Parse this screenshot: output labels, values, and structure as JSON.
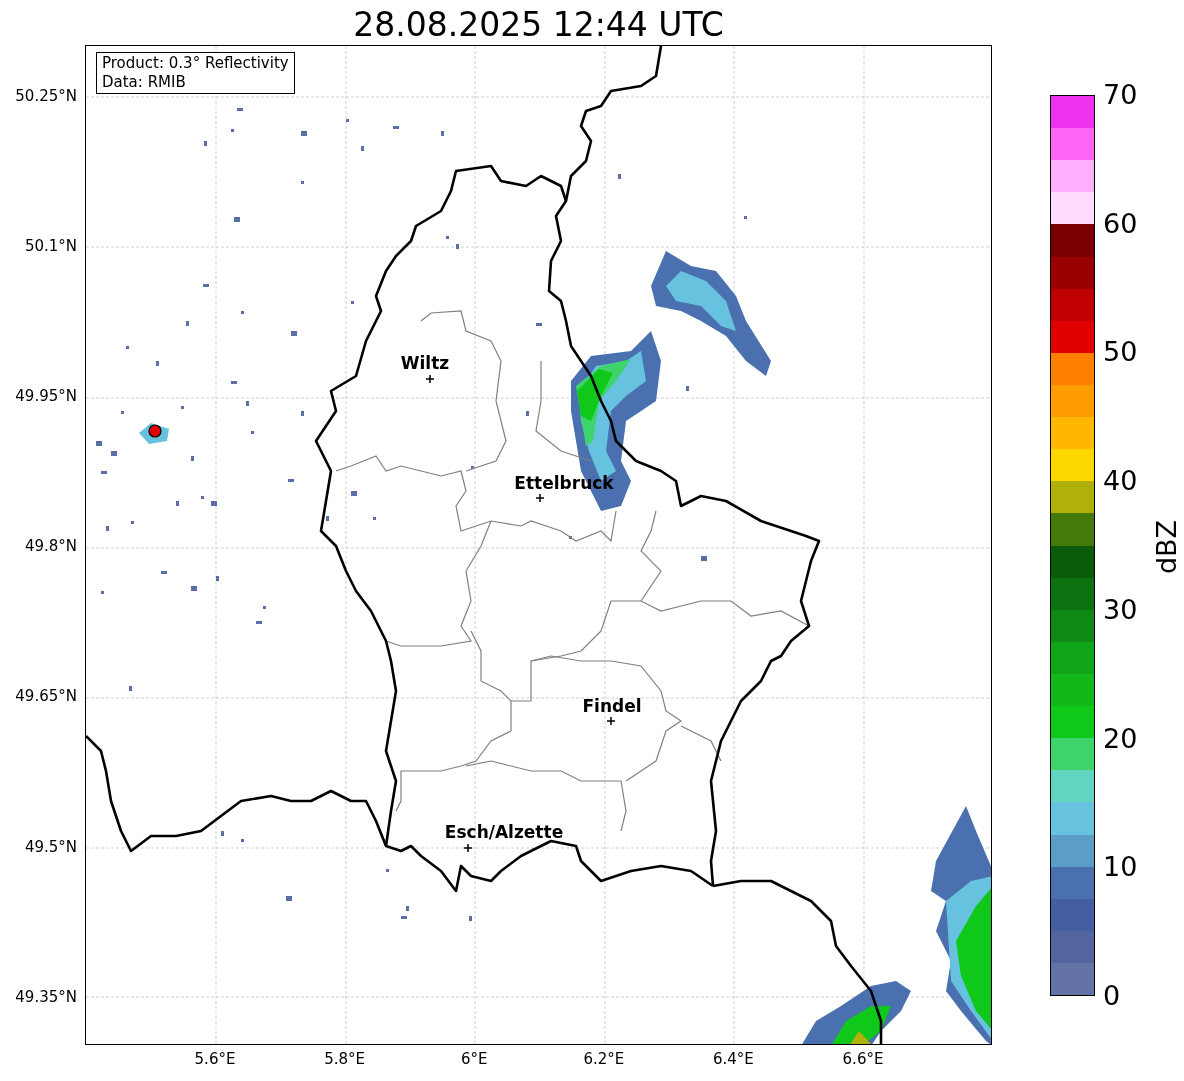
{
  "title": "28.08.2025 12:44 UTC",
  "info_box": {
    "lines": [
      "Product: 0.3° Reflectivity",
      "Data: RMIB"
    ]
  },
  "y_ticks": [
    "50.25°N",
    "50.1°N",
    "49.95°N",
    "49.8°N",
    "49.65°N",
    "49.5°N",
    "49.35°N"
  ],
  "x_ticks": [
    "5.6°E",
    "5.8°E",
    "6°E",
    "6.2°E",
    "6.4°E",
    "6.6°E"
  ],
  "places": [
    {
      "name": "Wiltz"
    },
    {
      "name": "Ettelbruck"
    },
    {
      "name": "Findel"
    },
    {
      "name": "Esch/Alzette"
    }
  ],
  "colorbar": {
    "label": "dBZ",
    "ticks": [
      "70",
      "60",
      "50",
      "40",
      "30",
      "20",
      "10",
      "0"
    ],
    "bins": [
      {
        "color": "#ee33ee"
      },
      {
        "color": "#ff66f8"
      },
      {
        "color": "#ffb0ff"
      },
      {
        "color": "#ffdcff"
      },
      {
        "color": "#780000"
      },
      {
        "color": "#9a0000"
      },
      {
        "color": "#c00000"
      },
      {
        "color": "#e00000"
      },
      {
        "color": "#ff8000"
      },
      {
        "color": "#ff9c00"
      },
      {
        "color": "#ffb700"
      },
      {
        "color": "#ffd700"
      },
      {
        "color": "#b0b00a"
      },
      {
        "color": "#457a0a"
      },
      {
        "color": "#0a5c0a"
      },
      {
        "color": "#0b720f"
      },
      {
        "color": "#0f8a14"
      },
      {
        "color": "#10a516"
      },
      {
        "color": "#12b818"
      },
      {
        "color": "#10c81a"
      },
      {
        "color": "#3dd46c"
      },
      {
        "color": "#60d6c0"
      },
      {
        "color": "#66c2de"
      },
      {
        "color": "#5a9ec8"
      },
      {
        "color": "#4a70b0"
      },
      {
        "color": "#435ea2"
      },
      {
        "color": "#53649e"
      },
      {
        "color": "#6473a7"
      }
    ]
  }
}
